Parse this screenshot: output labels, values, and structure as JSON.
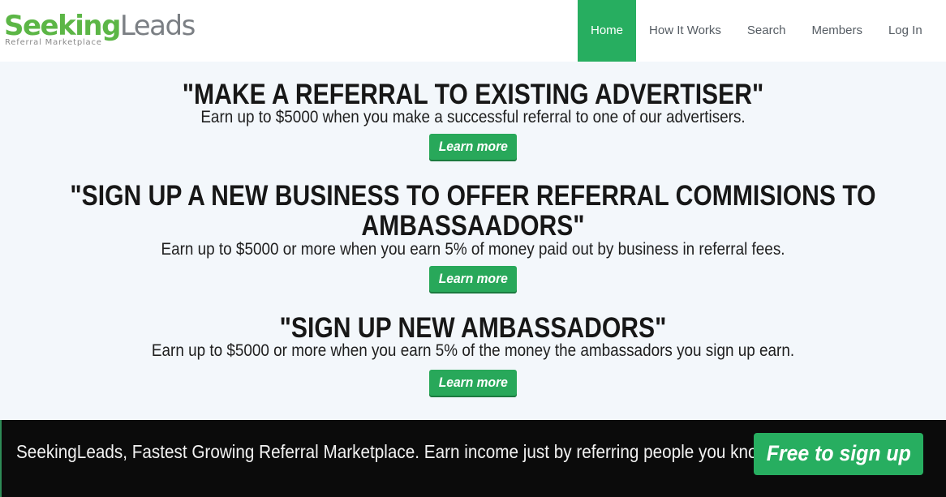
{
  "header": {
    "logo": {
      "seeking": "Seeking",
      "leads": "Leads",
      "tagline": "Referral Marketplace"
    },
    "nav": [
      "Home",
      "How It Works",
      "Search",
      "Members",
      "Log In"
    ],
    "active_nav": "Home"
  },
  "hero": {
    "blocks": [
      {
        "headline": "\"MAKE A REFERRAL TO EXISTING ADVERTISER\"",
        "subtext": "Earn up to $5000 when you make a successful referral to one of our advertisers.",
        "button": "Learn more"
      },
      {
        "headline_line1": "\"SIGN UP A NEW BUSINESS TO OFFER REFERRAL COMMISIONS TO",
        "headline_line2": "AMBASSAADORS\"",
        "subtext": "Earn up to $5000 or more when you earn 5% of money paid out by business in referral fees.",
        "button": "Learn more"
      },
      {
        "headline": "\"SIGN UP NEW AMBASSADORS\"",
        "subtext": "Earn up to $5000 or more when you earn 5% of the money the ambassadors you sign up earn.",
        "button": "Learn more"
      }
    ]
  },
  "banner": {
    "text": "SeekingLeads, Fastest Growing Referral Marketplace. Earn income just by referring people you know.",
    "button": "Free to sign up"
  },
  "colors": {
    "accent_green": "#27ae60",
    "logo_green": "#5cb646",
    "hero_background": "#f3f7fb",
    "banner_background": "#0b0b0b"
  }
}
